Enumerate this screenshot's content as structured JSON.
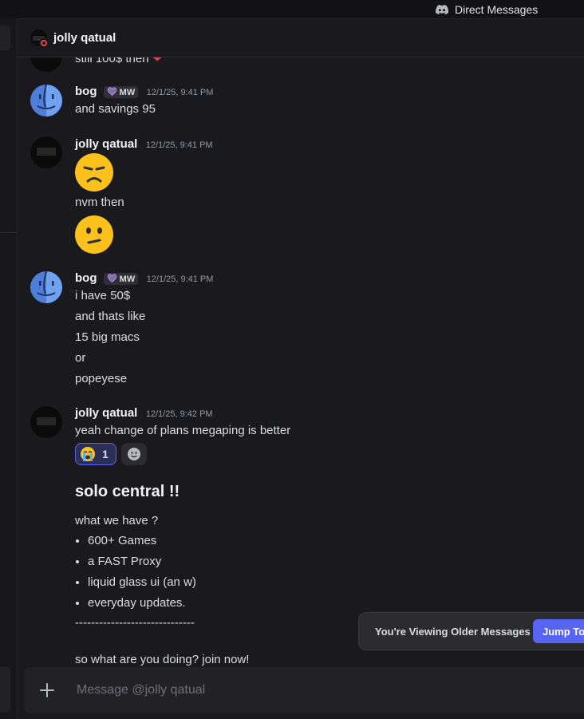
{
  "titlebar": {
    "label": "Direct Messages"
  },
  "header": {
    "name": "jolly qatual"
  },
  "messages": {
    "clipped_text": "still 100$ then",
    "m1": {
      "author": "bog",
      "tag": "MW",
      "timestamp": "12/1/25, 9:41 PM",
      "lines": [
        "and savings 95"
      ]
    },
    "m2": {
      "author": "jolly qatual",
      "timestamp": "12/1/25, 9:41 PM",
      "lines": [
        "nvm then"
      ]
    },
    "m3": {
      "author": "bog",
      "tag": "MW",
      "timestamp": "12/1/25, 9:41 PM",
      "lines": [
        "i have 50$",
        "and thats like",
        "15 big macs",
        "or",
        "popeyese"
      ]
    },
    "m4": {
      "author": "jolly qatual",
      "timestamp": "12/1/25, 9:42 PM",
      "lines": [
        "yeah change of plans megaping is better"
      ],
      "reaction_count": "1"
    },
    "promo": {
      "title": "solo central !!",
      "intro": "what we have ?",
      "items": [
        "600+ Games",
        "a FAST Proxy",
        "liquid glass ui (an w)",
        "everyday updates."
      ],
      "divider": "------------------------------",
      "cta": "so what are you doing? join now!"
    }
  },
  "banner": {
    "text": "You're Viewing Older Messages",
    "button": "Jump To"
  },
  "composer": {
    "placeholder": "Message @jolly qatual"
  },
  "colors": {
    "accent": "#5865f2",
    "background": "#1a1a1e",
    "status_dnd": "#e04349"
  }
}
